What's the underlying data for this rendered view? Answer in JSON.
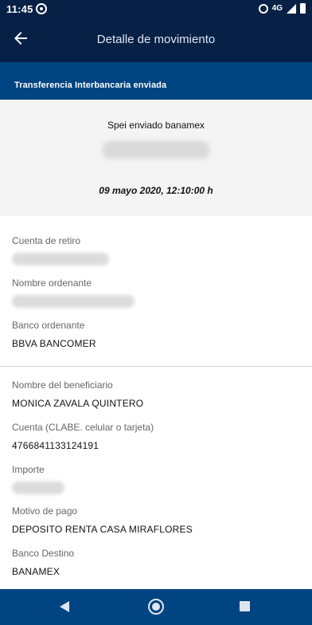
{
  "status_bar": {
    "time": "11:45",
    "network": "4G",
    "icons": [
      "whatsapp-icon",
      "alarm-icon",
      "signal-icon",
      "battery-icon"
    ]
  },
  "app_bar": {
    "title": "Detalle de movimiento",
    "back_icon": "arrow-left-icon"
  },
  "section": {
    "title": "Transferencia Interbancaria enviada"
  },
  "summary": {
    "concept": "Spei enviado banamex",
    "datetime": "09 mayo 2020, 12:10:00 h"
  },
  "ordering": {
    "account_label": "Cuenta de retiro",
    "name_label": "Nombre ordenante",
    "bank_label": "Banco ordenante",
    "bank_value": "BBVA BANCOMER"
  },
  "beneficiary": {
    "name_label": "Nombre del beneficiario",
    "name_value": "MONICA ZAVALA QUINTERO",
    "account_label": "Cuenta (CLABE. celular o tarjeta)",
    "account_value": "4766841133124191",
    "amount_label": "Importe",
    "reason_label": "Motivo de pago",
    "reason_value": "DEPOSITO RENTA CASA MIRAFLORES",
    "bank_label": "Banco Destino",
    "bank_value": "BANAMEX"
  },
  "nav": {
    "icons": [
      "back-triangle-icon",
      "home-circle-icon",
      "recents-square-icon"
    ]
  },
  "colors": {
    "app_bar": "#072146",
    "section_header": "#004481",
    "summary_bg": "#f4f4f4",
    "nav_bar": "#004481"
  }
}
